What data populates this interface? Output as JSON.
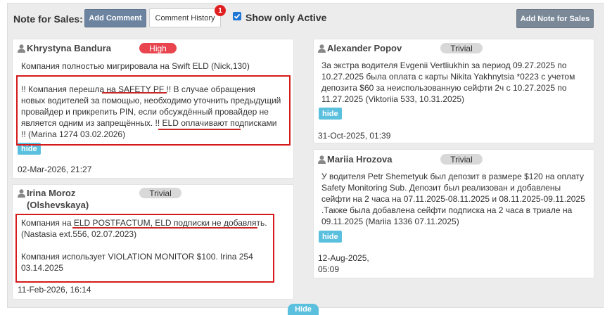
{
  "toolbar": {
    "label": "Note for Sales:",
    "add_comment": "Add Comment",
    "comment_history": "Comment History",
    "history_count": "1",
    "show_only_active": "Show only Active",
    "add_note": "Add Note for Sales"
  },
  "notes": [
    {
      "author": "Khrystyna Bandura",
      "priority": "High",
      "line1": "Компания полностью мигрировала на Swift ELD (Nick,130)",
      "body": "!! Компания перешла на SAFETY PF !! В случае обращения новых водителей за помощью, необходимо уточнить предыдущий провайдер и прикрепить PIN, если обсуждённый провайдер не является одним из запрещённых. !! ELD оплачивают подписками !! (Marina 1274 03.02.2026)",
      "hide": "hide",
      "date": "02-Mar-2026, 21:27"
    },
    {
      "author": "Irina Moroz (Olshevskaya)",
      "priority": "Trivial",
      "body": "Компания на ELD POSTFACTUM, ELD подписки не добавлять. (Nastasia ext.556, 02.07.2023)",
      "body2": "Компания использует VIOLATION MONITOR $100. Irina 254 03.14.2025",
      "date": "11-Feb-2026, 16:14"
    },
    {
      "author": "Alexander Popov",
      "priority": "Trivial",
      "body": "За экстра водителя Evgenii Vertliukhin за период 09.27.2025 по 10.27.2025 была оплата с карты Nikita Yakhnytsia *0223 с учетом депозита $60 за неиспользованную сейфти 2ч с 10.27.2025 по 11.27.2025 (Viktoriia 533, 10.31.2025)",
      "hide": "hide",
      "date": "31-Oct-2025, 01:39"
    },
    {
      "author": "Mariia Hrozova",
      "priority": "Trivial",
      "body": "У водителя Petr Shemetyuk был депозит в размере $120 на оплату Safety Monitoring Sub. Депозит был реализован и добавлены сейфти на 2 часа на 07.11.2025-08.11.2025 и 08.11.2025-09.11.2025 .Также была добавлена сейфти подписка на 2 часа в триале на 09.11.2025 (Mariia 1336 07.11.2025)",
      "hide": "hide",
      "date_line1": "12-Aug-2025,",
      "date_line2": "05:09"
    }
  ],
  "footer": {
    "hide": "Hide"
  },
  "colors": {
    "panel_bg": "#ececec",
    "primary_button": "#6d84a0",
    "high_badge": "#e8454f",
    "trivial_badge": "#d8d8d8",
    "hide_button": "#5bc0de",
    "annotation": "#d41a1a"
  }
}
